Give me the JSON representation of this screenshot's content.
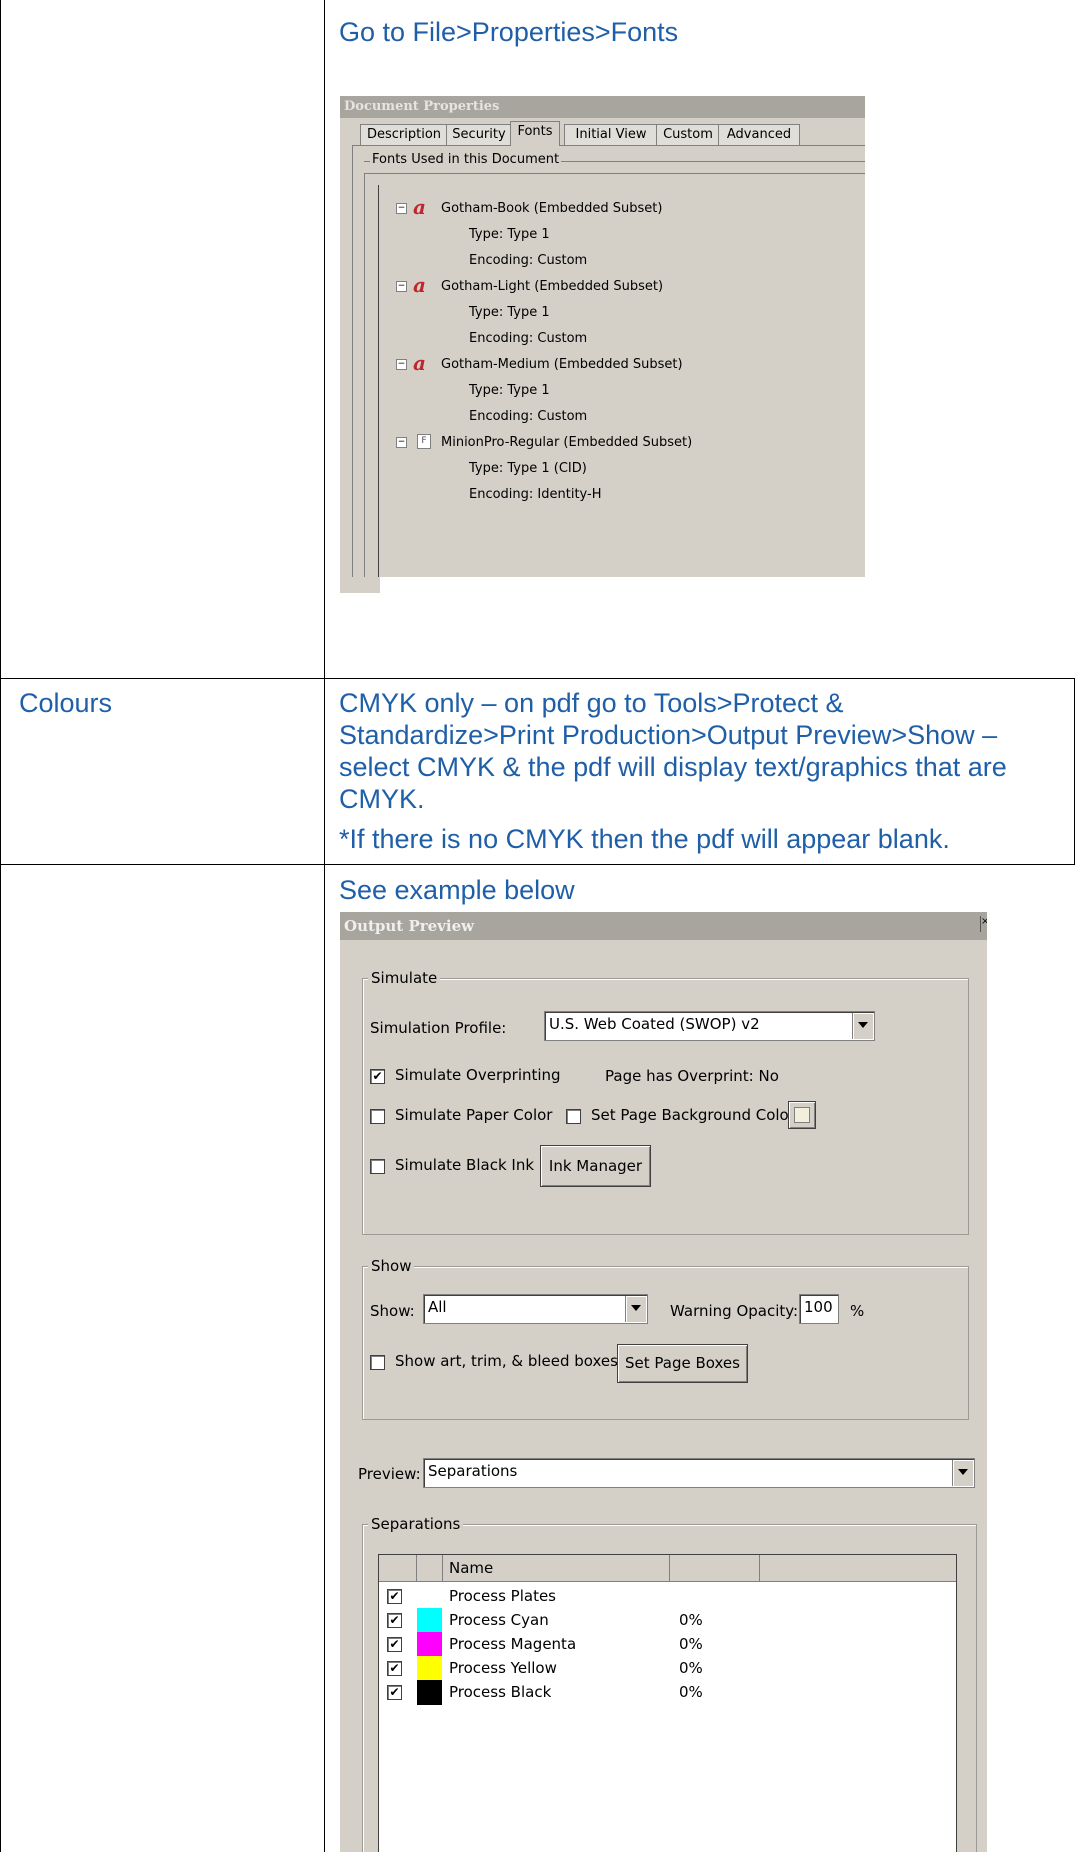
{
  "table": {
    "row1": {
      "left": "",
      "heading": "Go to File>Properties>Fonts"
    },
    "row2": {
      "left": "Colours",
      "text": "CMYK only – on pdf go to Tools>Protect & Standardize>Print Production>Output Preview>Show – select CMYK & the pdf will display text/graphics that are CMYK.",
      "note": "*If there is no CMYK then the pdf will appear blank."
    },
    "row3": {
      "left": "",
      "heading": "See example below"
    }
  },
  "doc_props": {
    "title": "Document Properties",
    "tabs": [
      "Description",
      "Security",
      "Fonts",
      "Initial View",
      "Custom",
      "Advanced"
    ],
    "active_tab": "Fonts",
    "group_label": "Fonts Used in this Document",
    "fonts": [
      {
        "name": "Gotham-Book (Embedded Subset)",
        "icon": "adobe-type1-icon",
        "type": "Type: Type 1",
        "encoding": "Encoding: Custom"
      },
      {
        "name": "Gotham-Light (Embedded Subset)",
        "icon": "adobe-type1-icon",
        "type": "Type: Type 1",
        "encoding": "Encoding: Custom"
      },
      {
        "name": "Gotham-Medium (Embedded Subset)",
        "icon": "adobe-type1-icon",
        "type": "Type: Type 1",
        "encoding": "Encoding: Custom"
      },
      {
        "name": "MinionPro-Regular (Embedded Subset)",
        "icon": "font-file-icon",
        "type": "Type: Type 1 (CID)",
        "encoding": "Encoding: Identity-H"
      }
    ],
    "tree_toggle": "⊟",
    "adobe_glyph": "a",
    "font_file_glyph": "F"
  },
  "output_preview": {
    "title": "Output Preview",
    "simulate": {
      "label": "Simulate",
      "profile_label": "Simulation Profile:",
      "profile_value": "U.S. Web Coated (SWOP) v2",
      "overprinting_label": "Simulate Overprinting",
      "overprinting_checked": true,
      "overprint_status": "Page has Overprint:  No",
      "paper_color_label": "Simulate Paper Color",
      "paper_color_checked": false,
      "bg_color_label": "Set Page Background Color",
      "bg_color_checked": false,
      "black_ink_label": "Simulate Black Ink",
      "black_ink_checked": false,
      "ink_manager_button": "Ink Manager"
    },
    "show": {
      "label": "Show",
      "show_label": "Show:",
      "show_value": "All",
      "warning_label": "Warning Opacity:",
      "warning_value": "100",
      "warning_unit": "%",
      "boxes_label": "Show art, trim, & bleed boxes",
      "boxes_checked": false,
      "set_page_boxes_button": "Set Page Boxes"
    },
    "preview": {
      "label": "Preview:",
      "value": "Separations"
    },
    "separations": {
      "label": "Separations",
      "column_name": "Name",
      "rows": [
        {
          "name": "Process Plates",
          "checked": true,
          "color": "",
          "value": ""
        },
        {
          "name": "Process Cyan",
          "checked": true,
          "color": "#00ffff",
          "value": "0%"
        },
        {
          "name": "Process Magenta",
          "checked": true,
          "color": "#ff00ff",
          "value": "0%"
        },
        {
          "name": "Process Yellow",
          "checked": true,
          "color": "#ffff00",
          "value": "0%"
        },
        {
          "name": "Process Black",
          "checked": true,
          "color": "#000000",
          "value": "0%"
        }
      ]
    },
    "check_glyph": "✔"
  }
}
